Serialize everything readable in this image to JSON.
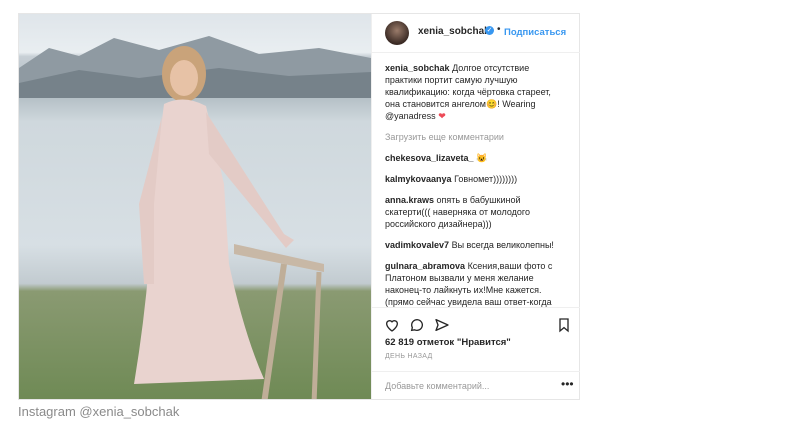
{
  "header": {
    "username": "xenia_sobchak",
    "dot": "•",
    "follow_label": "Подписаться"
  },
  "comments": [
    {
      "user": "xenia_sobchak",
      "text": "Долгое отсутствие практики портит самую лучшую квалификацию: когда чёртовка стареет, она становится ангелом😊! Wearing @yanadress",
      "suffix": "❤"
    },
    {
      "more": "Загрузить еще комментарии"
    },
    {
      "user": "chekesova_lizaveta_",
      "text": "😺"
    },
    {
      "user": "kalmykovaanya",
      "text": "Говномет))))))))"
    },
    {
      "user": "anna.kraws",
      "text": "опять в бабушкиной скатерти((( наверняка от молодого российского дизайнера)))"
    },
    {
      "user": "vadimkovalev7",
      "text": "Вы всегда великолепны!"
    },
    {
      "user": "gulnara_abramova",
      "text": "Ксения,ваши фото с Платоном вызвали у меня желание наконец-то лайкнуть их!Мне кажется. (прямо сейчас увидела ваш ответ-когда кажется креститься надо😉),и все равное продолжу,что вы другая,не стерва,а"
    }
  ],
  "actions": {
    "likes": "62 819 отметок \"Нравится\"",
    "date": "ДЕНЬ НАЗАД",
    "add_comment_placeholder": "Добавьте комментарий...",
    "icons": [
      "heart-icon",
      "comment-icon",
      "share-icon",
      "bookmark-icon",
      "more-options-icon"
    ]
  },
  "caption": "Instagram @xenia_sobchak",
  "colors": {
    "link": "#3897f0",
    "text": "#262626",
    "muted": "#999999",
    "heart": "#ed4956"
  }
}
